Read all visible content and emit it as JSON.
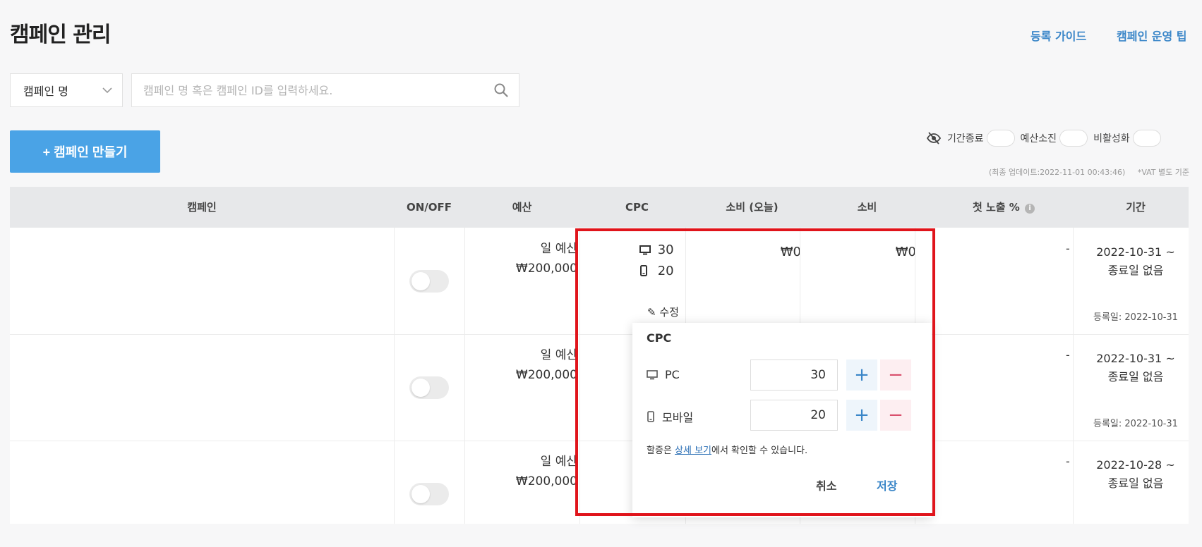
{
  "header": {
    "title": "캠페인 관리",
    "links": [
      "등록 가이드",
      "캠페인 운영 팁"
    ]
  },
  "search": {
    "select_value": "캠페인 명",
    "placeholder": "캠페인 명 혹은 캠페인 ID를 입력하세요."
  },
  "toolbar": {
    "create_label": "+ 캠페인 만들기",
    "filters": [
      "기간종료",
      "예산소진",
      "비활성화"
    ],
    "update_note": "(최종 업데이트:2022-11-01 00:43:46)",
    "vat_note": "*VAT 별도 기준"
  },
  "table": {
    "columns": [
      "캠페인",
      "ON/OFF",
      "예산",
      "CPC",
      "소비 (오늘)",
      "소비",
      "첫 노출 %",
      "기간"
    ],
    "rows": [
      {
        "budget_label": "일 예산",
        "budget": "₩200,000",
        "cpc_pc": "30",
        "cpc_mobile": "20",
        "edit": "수정",
        "spend_today": "₩0",
        "spend": "₩0",
        "first_exposure": "-",
        "period_start": "2022-10-31 ~",
        "period_end": "종료일 없음",
        "registered": "등록일: 2022-10-31"
      },
      {
        "budget_label": "일 예산",
        "budget": "₩200,000",
        "first_exposure": "-",
        "period_start": "2022-10-31 ~",
        "period_end": "종료일 없음",
        "registered": "등록일: 2022-10-31"
      },
      {
        "budget_label": "일 예산",
        "budget": "₩200,000",
        "first_exposure": "-",
        "period_start": "2022-10-28 ~",
        "period_end": "종료일 없음"
      }
    ]
  },
  "cpc_popup": {
    "title": "CPC",
    "pc_label": "PC",
    "pc_value": "30",
    "mobile_label": "모바일",
    "mobile_value": "20",
    "plus": "+",
    "minus": "−",
    "note_before": "할증은 ",
    "note_link": "상세 보기",
    "note_after": "에서 확인할 수 있습니다.",
    "cancel": "취소",
    "save": "저장"
  },
  "colors": {
    "accent": "#4aa3e6",
    "link": "#3a86c8",
    "highlight": "#e0141b"
  }
}
